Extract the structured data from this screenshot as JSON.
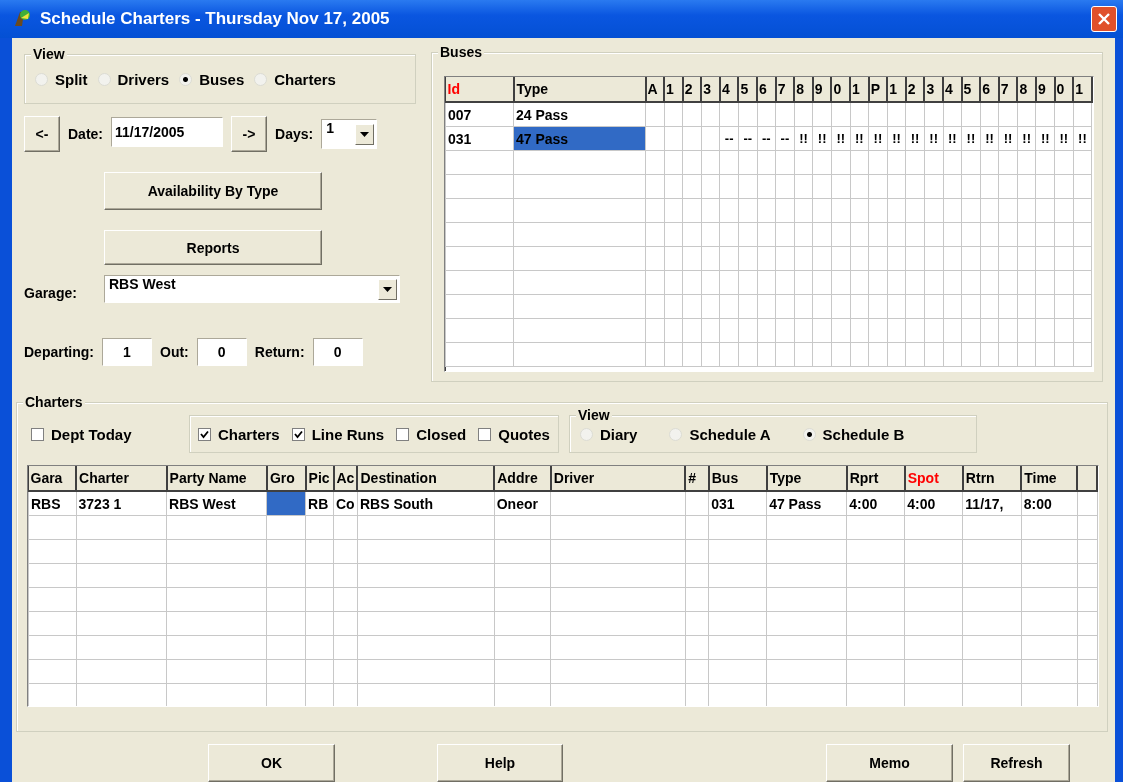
{
  "window": {
    "title": "Schedule Charters - Thursday Nov 17, 2005"
  },
  "view": {
    "label": "View",
    "options": [
      {
        "label": "Split",
        "selected": false
      },
      {
        "label": "Drivers",
        "selected": false
      },
      {
        "label": "Buses",
        "selected": true
      },
      {
        "label": "Charters",
        "selected": false
      }
    ]
  },
  "date_nav": {
    "prev": "<-",
    "date_label": "Date:",
    "date": "11/17/2005",
    "next": "->",
    "days_label": "Days:",
    "days": "1"
  },
  "actions": [
    "Availability By Type",
    "Reports"
  ],
  "garage": {
    "label": "Garage:",
    "value": "RBS West"
  },
  "counts": [
    {
      "label": "Departing:",
      "value": "1"
    },
    {
      "label": "Out:",
      "value": "0"
    },
    {
      "label": "Return:",
      "value": "0"
    }
  ],
  "buses": {
    "label": "Buses",
    "columns": [
      {
        "label": "Id",
        "color": "#ff0000"
      },
      {
        "label": "Type",
        "color": "#000000"
      }
    ],
    "hours": [
      "A",
      "1",
      "2",
      "3",
      "4",
      "5",
      "6",
      "7",
      "8",
      "9",
      "0",
      "1",
      "P",
      "1",
      "2",
      "3",
      "4",
      "5",
      "6",
      "7",
      "8",
      "9",
      "0",
      "1"
    ],
    "rows": [
      {
        "id": "007",
        "type": "24 Pass",
        "selected": false,
        "slots": [
          {
            "kind": "free"
          },
          {
            "kind": "free"
          },
          {
            "kind": "free"
          },
          {
            "kind": "free"
          },
          {
            "kind": "free"
          },
          {
            "kind": "free"
          },
          {
            "kind": "free"
          },
          {
            "kind": "free"
          },
          {
            "kind": "free"
          },
          {
            "kind": "free"
          },
          {
            "kind": "free"
          },
          {
            "kind": "free"
          },
          {
            "kind": "free"
          },
          {
            "kind": "free"
          },
          {
            "kind": "free"
          },
          {
            "kind": "free"
          },
          {
            "kind": "free"
          },
          {
            "kind": "free"
          },
          {
            "kind": "free"
          },
          {
            "kind": "free"
          },
          {
            "kind": "free"
          },
          {
            "kind": "free"
          },
          {
            "kind": "free"
          },
          {
            "kind": "free"
          }
        ]
      },
      {
        "id": "031",
        "type": "47 Pass",
        "selected": true,
        "slots": [
          {
            "kind": "free"
          },
          {
            "kind": "free"
          },
          {
            "kind": "free"
          },
          {
            "kind": "free"
          },
          {
            "kind": "mark",
            "text": "--"
          },
          {
            "kind": "mark",
            "text": "--"
          },
          {
            "kind": "mark",
            "text": "--"
          },
          {
            "kind": "mark",
            "text": "--"
          },
          {
            "kind": "mark",
            "text": "!!"
          },
          {
            "kind": "mark",
            "text": "!!"
          },
          {
            "kind": "mark",
            "text": "!!"
          },
          {
            "kind": "mark",
            "text": "!!"
          },
          {
            "kind": "mark",
            "text": "!!"
          },
          {
            "kind": "mark",
            "text": "!!"
          },
          {
            "kind": "mark",
            "text": "!!"
          },
          {
            "kind": "mark",
            "text": "!!"
          },
          {
            "kind": "mark",
            "text": "!!"
          },
          {
            "kind": "mark",
            "text": "!!"
          },
          {
            "kind": "mark",
            "text": "!!"
          },
          {
            "kind": "mark",
            "text": "!!"
          },
          {
            "kind": "mark",
            "text": "!!"
          },
          {
            "kind": "mark",
            "text": "!!"
          },
          {
            "kind": "mark",
            "text": "!!"
          },
          {
            "kind": "mark",
            "text": "!!"
          }
        ]
      }
    ]
  },
  "charters": {
    "label": "Charters",
    "dept_today": {
      "label": "Dept Today",
      "checked": false
    },
    "types": [
      {
        "label": "Charters",
        "checked": true
      },
      {
        "label": "Line Runs",
        "checked": true
      },
      {
        "label": "Closed",
        "checked": false
      },
      {
        "label": "Quotes",
        "checked": false
      }
    ],
    "view": {
      "label": "View",
      "options": [
        {
          "label": "Diary",
          "selected": false
        },
        {
          "label": "Schedule A",
          "selected": false
        },
        {
          "label": "Schedule B",
          "selected": true
        }
      ]
    },
    "columns": [
      {
        "label": "Gara",
        "color": "#000000"
      },
      {
        "label": "Charter",
        "color": "#000000"
      },
      {
        "label": "Party Name",
        "color": "#000000"
      },
      {
        "label": "Gro",
        "color": "#000000"
      },
      {
        "label": "Pic",
        "color": "#000000"
      },
      {
        "label": "Ac",
        "color": "#000000"
      },
      {
        "label": "Destination",
        "color": "#000000"
      },
      {
        "label": "Addre",
        "color": "#000000"
      },
      {
        "label": "Driver",
        "color": "#000000"
      },
      {
        "label": "#",
        "color": "#000000"
      },
      {
        "label": "Bus",
        "color": "#000000"
      },
      {
        "label": "Type",
        "color": "#000000"
      },
      {
        "label": "Rprt",
        "color": "#000000"
      },
      {
        "label": "Spot",
        "color": "#ff0000"
      },
      {
        "label": "Rtrn",
        "color": "#000000"
      },
      {
        "label": "Time",
        "color": "#000000"
      }
    ],
    "rows": [
      {
        "selected": true,
        "cells": [
          {
            "kind": "text",
            "text": "RBS"
          },
          {
            "kind": "text",
            "text": "3723 1"
          },
          {
            "kind": "text",
            "text": "RBS West"
          },
          {
            "kind": "blank"
          },
          {
            "kind": "text",
            "text": "RB"
          },
          {
            "kind": "text",
            "text": "Co"
          },
          {
            "kind": "text",
            "text": "RBS South"
          },
          {
            "kind": "text",
            "text": "Oneor"
          },
          {
            "kind": "blank"
          },
          {
            "kind": "blank"
          },
          {
            "kind": "text",
            "text": "031"
          },
          {
            "kind": "text",
            "text": "47 Pass"
          },
          {
            "kind": "text",
            "text": "4:00"
          },
          {
            "kind": "text",
            "text": "4:00"
          },
          {
            "kind": "text",
            "text": "11/17,"
          },
          {
            "kind": "text",
            "text": "8:00"
          }
        ]
      }
    ]
  },
  "buttons": [
    "OK",
    "Help",
    "Memo",
    "Refresh"
  ]
}
